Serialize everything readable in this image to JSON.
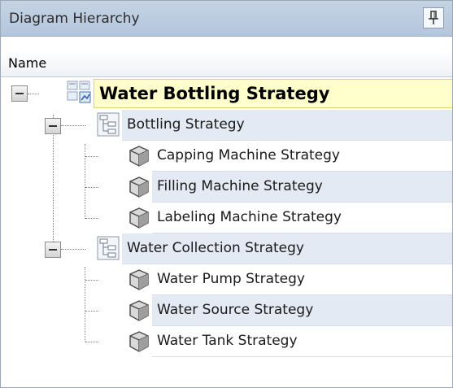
{
  "panel": {
    "title": "Diagram Hierarchy",
    "pin_icon": "pin-icon",
    "column_header": "Name"
  },
  "tree": {
    "root": {
      "label": "Water Bottling Strategy",
      "icon": "diagram-icon",
      "expanded": true,
      "children": [
        {
          "label": "Bottling Strategy",
          "icon": "hierarchy-icon",
          "expanded": true,
          "children": [
            {
              "label": "Capping Machine Strategy",
              "icon": "cube-icon"
            },
            {
              "label": "Filling Machine Strategy",
              "icon": "cube-icon"
            },
            {
              "label": "Labeling Machine Strategy",
              "icon": "cube-icon"
            }
          ]
        },
        {
          "label": "Water Collection Strategy",
          "icon": "hierarchy-icon",
          "expanded": true,
          "children": [
            {
              "label": "Water Pump Strategy",
              "icon": "cube-icon"
            },
            {
              "label": "Water Source Strategy",
              "icon": "cube-icon"
            },
            {
              "label": "Water Tank Strategy",
              "icon": "cube-icon"
            }
          ]
        }
      ]
    }
  }
}
